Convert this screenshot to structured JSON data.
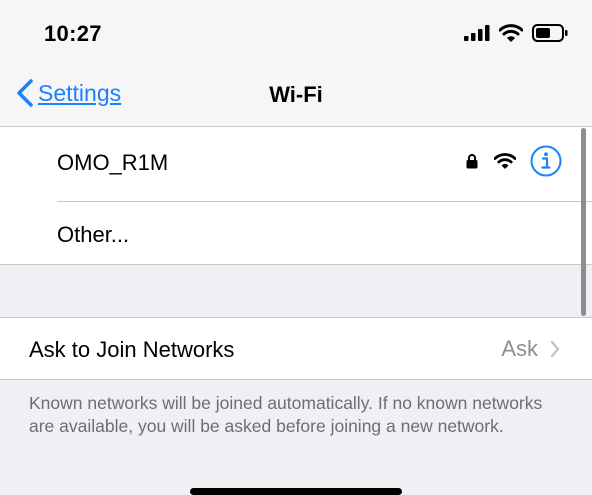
{
  "status_bar": {
    "time": "10:27"
  },
  "nav": {
    "back_label": "Settings",
    "title": "Wi-Fi"
  },
  "networks": [
    {
      "name": "OMO_R1M",
      "secured": true,
      "icons": [
        "lock-icon",
        "wifi-icon",
        "info-icon"
      ]
    },
    {
      "name": "Other...",
      "secured": false,
      "icons": []
    }
  ],
  "ask_to_join": {
    "label": "Ask to Join Networks",
    "value": "Ask"
  },
  "footnote": "Known networks will be joined automatically. If no known networks are available, you will be asked before joining a new network.",
  "colors": {
    "accent": "#1a82fb",
    "background": "#efeff4",
    "secondary_text": "#8e8e93",
    "footnote_text": "#6d6d72"
  }
}
